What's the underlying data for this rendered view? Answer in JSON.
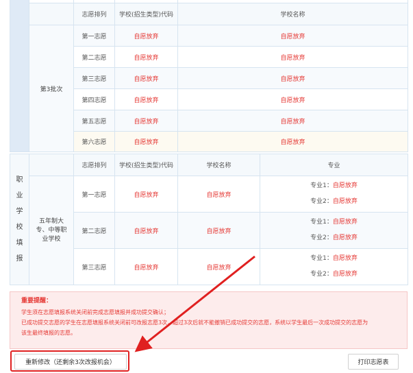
{
  "table1": {
    "headers": {
      "order": "志愿排列",
      "school_code": "学校(招生类型)代码",
      "school_name": "学校名称"
    },
    "batch_label": "第3批次",
    "rows": [
      {
        "order": "第一志愿",
        "code": "自愿放弃",
        "name": "自愿放弃"
      },
      {
        "order": "第二志愿",
        "code": "自愿放弃",
        "name": "自愿放弃"
      },
      {
        "order": "第三志愿",
        "code": "自愿放弃",
        "name": "自愿放弃"
      },
      {
        "order": "第四志愿",
        "code": "自愿放弃",
        "name": "自愿放弃"
      },
      {
        "order": "第五志愿",
        "code": "自愿放弃",
        "name": "自愿放弃"
      },
      {
        "order": "第六志愿",
        "code": "自愿放弃",
        "name": "自愿放弃"
      }
    ]
  },
  "table2": {
    "side_label": [
      "职",
      "业",
      "学",
      "校",
      "填",
      "报"
    ],
    "headers": {
      "order": "志愿排列",
      "school_code": "学校(招生类型)代码",
      "school_name": "学校名称",
      "major": "专业"
    },
    "category": "五年制大专、中等职业学校",
    "rows": [
      {
        "order": "第一志愿",
        "code": "自愿放弃",
        "name": "自愿放弃",
        "major1_label": "专业1：",
        "major1_value": "自愿放弃",
        "major2_label": "专业2：",
        "major2_value": "自愿放弃"
      },
      {
        "order": "第二志愿",
        "code": "自愿放弃",
        "name": "自愿放弃",
        "major1_label": "专业1：",
        "major1_value": "自愿放弃",
        "major2_label": "专业2：",
        "major2_value": "自愿放弃"
      },
      {
        "order": "第三志愿",
        "code": "自愿放弃",
        "name": "自愿放弃",
        "major1_label": "专业1：",
        "major1_value": "自愿放弃",
        "major2_label": "专业2：",
        "major2_value": "自愿放弃"
      }
    ]
  },
  "notice": {
    "title": "重要提醒：",
    "lines": [
      "学生须在志愿填报系统关闭前完成志愿填报并成功提交确认；",
      "已成功提交志愿的学生在志愿填报系统关闭前可改报志愿3次，超过3次后就不能撤销已成功提交的志愿，系统以学生最后一次成功提交的志愿为",
      "该生最终填报的志愿。"
    ]
  },
  "buttons": {
    "modify": "重新修改（还剩余3次改报机会）",
    "print": "打印志愿表"
  },
  "colors": {
    "accent_red": "#e53935",
    "side_blue": "#dfeaf6",
    "border": "#d6e4f0",
    "notice_bg": "#fdecec"
  }
}
